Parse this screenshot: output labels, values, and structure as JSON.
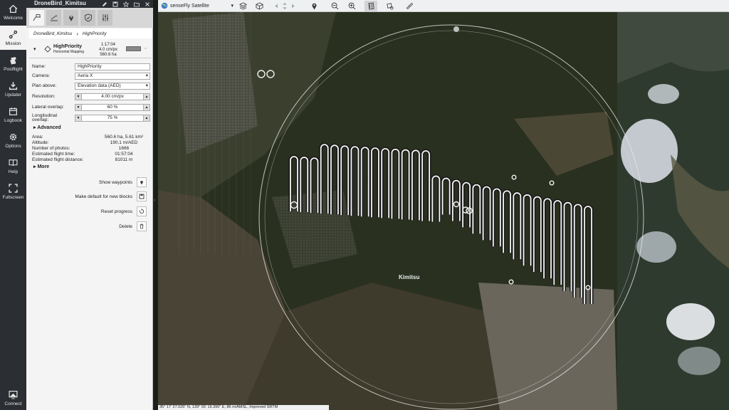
{
  "panel": {
    "project_title": "DroneBird_Kimitsu",
    "breadcrumb": [
      "DroneBird_Kimitsu",
      "HighPriority"
    ],
    "block": {
      "name": "HighPriority",
      "type": "Horizontal Mapping",
      "time": "1:17:04",
      "resolution": "4.0 cm/px",
      "area": "560.6 ha"
    },
    "fields": {
      "name_label": "Name:",
      "name_value": "HighPriority",
      "camera_label": "Camera:",
      "camera_value": "Aeria X",
      "plan_above_label": "Plan above:",
      "plan_above_value": "Elevation data (AED)",
      "resolution_label": "Resolution:",
      "resolution_value": "4.00 cm/px",
      "lateral_label": "Lateral overlap:",
      "lateral_value": "60 %",
      "longitudinal_label": "Longitudinal overlap:",
      "longitudinal_value": "75 %"
    },
    "advanced_label": "Advanced",
    "stats": [
      {
        "label": "Area:",
        "value": "560.6 ha, 5.61 km²"
      },
      {
        "label": "Altitude:",
        "value": "190.1 m/AED"
      },
      {
        "label": "Number of photos:",
        "value": "1666"
      },
      {
        "label": "Estimated flight time:",
        "value": "01:57:04"
      },
      {
        "label": "Estimated flight distance:",
        "value": "81011 m"
      }
    ],
    "more_label": "More",
    "actions": {
      "show_waypoints": "Show waypoints",
      "make_default": "Make default for new blocks",
      "reset_progress": "Reset progress",
      "delete": "Delete"
    }
  },
  "rail": [
    "Welcome",
    "Mission",
    "Postflight",
    "Updater",
    "Logbook",
    "Options",
    "Help",
    "Fullscreen",
    "Connect"
  ],
  "toolbar": {
    "map_source": "senseFly Satellite"
  },
  "map": {
    "town_label": "Kimitsu"
  },
  "status": "35°  17' 27.025\" N, 139°  55' 19.390\" E, 86 m/AMSL, Improved SRTM"
}
